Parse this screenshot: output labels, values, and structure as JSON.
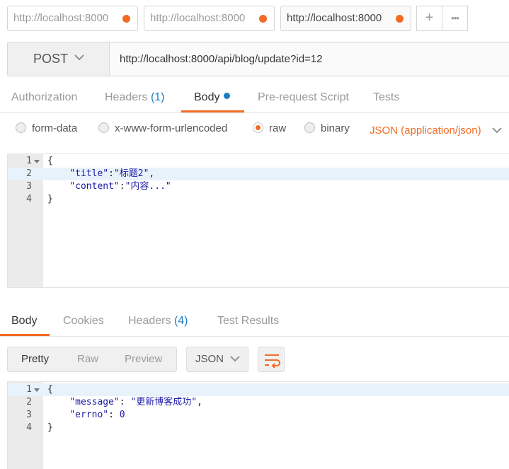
{
  "request_tabs": [
    {
      "label": "http://localhost:8000",
      "active": false
    },
    {
      "label": "http://localhost:8000",
      "active": false
    },
    {
      "label": "http://localhost:8000",
      "active": true
    }
  ],
  "tab_actions": {
    "new_tab": "+",
    "more": "•••"
  },
  "request": {
    "method": "POST",
    "url": "http://localhost:8000/api/blog/update?id=12"
  },
  "request_sections": {
    "authorization": "Authorization",
    "headers": "Headers",
    "headers_count": "(1)",
    "body": "Body",
    "pre_request": "Pre-request Script",
    "tests": "Tests"
  },
  "body_modes": {
    "form_data": "form-data",
    "urlencoded": "x-www-form-urlencoded",
    "raw": "raw",
    "binary": "binary",
    "selected": "raw",
    "content_type": "JSON (application/json)"
  },
  "request_body_lines": [
    {
      "num": "1",
      "text": "{"
    },
    {
      "num": "2",
      "indent": "    ",
      "key": "\"title\"",
      "sep": ":",
      "value": "\"标题2\"",
      "tail": ","
    },
    {
      "num": "3",
      "indent": "    ",
      "key": "\"content\"",
      "sep": ":",
      "value": "\"内容...\"",
      "tail": ""
    },
    {
      "num": "4",
      "text": "}"
    }
  ],
  "response_sections": {
    "body": "Body",
    "cookies": "Cookies",
    "headers": "Headers",
    "headers_count": "(4)",
    "test_results": "Test Results"
  },
  "response_view": {
    "pretty": "Pretty",
    "raw": "Raw",
    "preview": "Preview",
    "format": "JSON"
  },
  "response_body_lines": [
    {
      "num": "1",
      "text": "{"
    },
    {
      "num": "2",
      "indent": "    ",
      "key": "\"message\"",
      "sep": ": ",
      "value": "\"更新博客成功\"",
      "tail": ","
    },
    {
      "num": "3",
      "indent": "    ",
      "key": "\"errno\"",
      "sep": ": ",
      "value": "0",
      "tail": ""
    },
    {
      "num": "4",
      "text": "}"
    }
  ],
  "colors": {
    "accent": "#f26b24",
    "link_blue": "#1f7dc4",
    "string_blue": "#1a1aa6"
  }
}
